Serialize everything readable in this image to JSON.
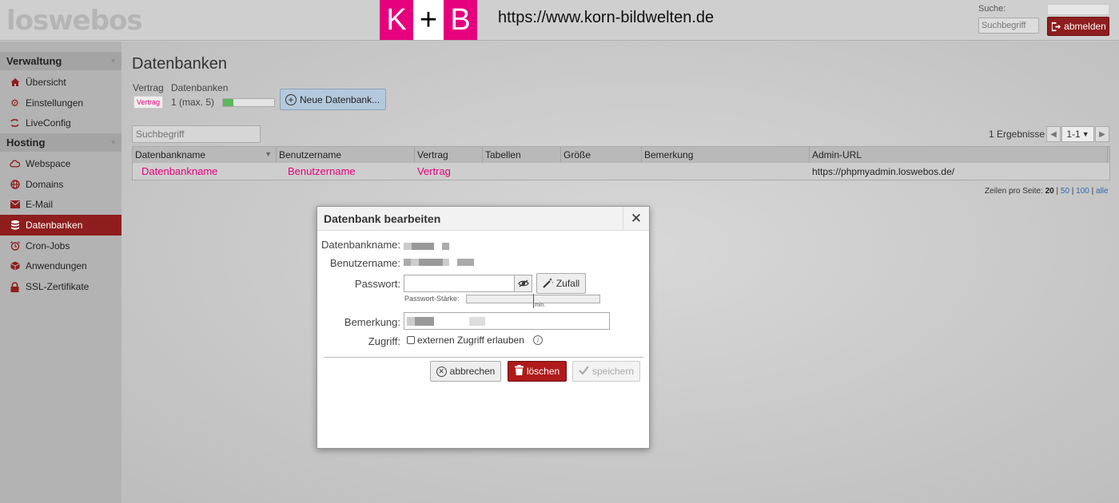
{
  "header": {
    "logo_text": "loswebos",
    "kb_letters": [
      "K",
      "+",
      "B"
    ],
    "kb_url": "https://www.korn-bildwelten.de",
    "search_label": "Suche:",
    "search_placeholder": "Suchbegriff",
    "logout_label": "abmelden",
    "logout_icon": "logout-icon"
  },
  "sidebar": {
    "sections": [
      {
        "title": "Verwaltung",
        "items": [
          {
            "label": "Übersicht",
            "icon": "home-icon"
          },
          {
            "label": "Einstellungen",
            "icon": "gear-icon"
          },
          {
            "label": "LiveConfig",
            "icon": "sync-icon"
          }
        ]
      },
      {
        "title": "Hosting",
        "items": [
          {
            "label": "Webspace",
            "icon": "cloud-icon"
          },
          {
            "label": "Domains",
            "icon": "globe-icon"
          },
          {
            "label": "E-Mail",
            "icon": "mail-icon"
          },
          {
            "label": "Datenbanken",
            "icon": "database-icon",
            "active": true
          },
          {
            "label": "Cron-Jobs",
            "icon": "alarm-clock-icon"
          },
          {
            "label": "Anwendungen",
            "icon": "package-icon"
          },
          {
            "label": "SSL-Zertifikate",
            "icon": "lock-icon"
          }
        ]
      }
    ]
  },
  "main": {
    "title": "Datenbanken",
    "quota": {
      "header_contract": "Vertrag",
      "header_databases": "Datenbanken",
      "contract_badge": "Vertrag",
      "count_text": "1  (max. 5)",
      "usage_fraction": 0.2
    },
    "new_button_label": "Neue Datenbank...",
    "filter_placeholder": "Suchbegriff",
    "results_text": "1 Ergebnisse",
    "pager_value": "1-1",
    "table": {
      "columns": [
        "Datenbankname",
        "Benutzername",
        "Vertrag",
        "Tabellen",
        "Größe",
        "Bemerkung",
        "Admin-URL"
      ],
      "rows": [
        [
          "Datenbankname",
          "Benutzername",
          "Vertrag",
          "",
          "",
          "",
          "https://phpmyadmin.loswebos.de/"
        ]
      ]
    },
    "per_page": {
      "label": "Zeilen pro Seite:",
      "options": [
        "20",
        "50",
        "100",
        "alle"
      ],
      "selected": "20"
    }
  },
  "modal": {
    "title": "Datenbank bearbeiten",
    "close_symbol": "✕",
    "db_name_label": "Datenbankname:",
    "user_label": "Benutzername:",
    "password_label": "Passwort:",
    "random_label": "Zufall",
    "strength_label": "Passwort-Stärke:",
    "strength_min": "min.",
    "remark_label": "Bemerkung:",
    "access_label": "Zugriff:",
    "access_checkbox_label": "externen Zugriff erlauben",
    "access_checked": false,
    "cancel_label": "abbrechen",
    "delete_label": "löschen",
    "save_label": "speichern"
  }
}
